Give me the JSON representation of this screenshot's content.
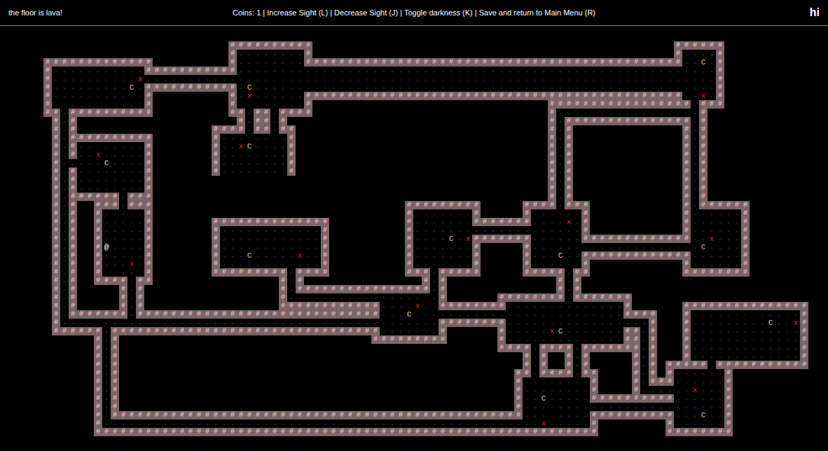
{
  "title": "the floor is lava!",
  "status": "Coins: 1 | Increase Sight (L) | Decrease Sight (J) | Toggle darkness (K) | Save and return to Main Menu (R)",
  "user": "hi",
  "map": {
    "rows": [
      "                      ##########                                           ######",
      "                      #........#                                           #....#",
      "#############         #........#############################################..C.#",
      "#...........###########.........................................................#",
      "#..........x....................................................................#",
      "#.........C.###########.C.......................................................#",
      "#...........#         #.x......#############################################..x.#",
      "#...........#         #........#                            #################.###",
      "##.##########         ##.##.####                            #.................#",
      " #.#                   #.##.#                               #.###############.#",
      " #.#                ####.##.##                              #.#             #.#",
      " #.##########       #........#                              #.#             #.#",
      " #.#........#       #..xC....#                              #.#             #.#",
      " #.#..x.....#       #........#                              #.#             #.#",
      " #.....C....#       #........#                              #.#             #.#",
      " #.#........#       #........#                              #.#             #.#",
      " #.#........#                                               #.#             #.#",
      " #.#........#                                               #.#             #.#",
      " #.######.###                                               #.#             #.#",
      " #.#  ###.###                              #########     ####.###           #.######",
      " #.#  #.....#                              #.......#     #......#           #......#",
      " #.#  #.....#       ##############         #.......#######....x.#           #......#",
      " #.#  #.....#       #............#         #....................#           #......#",
      " #.#  #.....#       #............#         #....C.x#######......#############..x...#",
      " #.#  #@....#       #............#         #.......#     #....................C....#",
      " #.#  #.....#       #...C.....x..#         #.......#     #...C..#############......#",
      " #.#  #...x.#       #............#         #.......#     #......#           #......#",
      " #.#  #.....#       #########.####         ###.#####     #####.##           ########",
      " #.#  ####.##               #.#              #.#             #.#",
      " #.#     #.#                #.################.#             #.#",
      " #.#     #.#                #..................#      ########.#######",
      " #.#     #.#                ############....x..########..............#      ###############",
      " #.#######.#############################...C.........................####   #.............#",
      " #.............................................########.................#   #.........C..x#",
      " ######.################################.......#      #.....xC.......##.#   #.............#",
      "      #.#                              #########      #..............##.#   #.............#",
      "      #.#                                             ####.####.#######.#   #.............#",
      "      #.#                                                #.#  #.#     #.#   #.............#",
      "      #.#                                                #.#  #.#     #.# #####.###########",
      "      #.#                                               ##.####.##    #.# #......#",
      "      #.#                                               #........#    #.###......#",
      "      #.#                                               #........#    #......x...#",
      "      #.#                                               #..C.....##########......#",
      "      #.#                                               #........................#",
      "      #.#################################################........##########...C..#",
      "      #....................................................x.....#        #......#",
      "      ############################################################        ########"
    ]
  }
}
